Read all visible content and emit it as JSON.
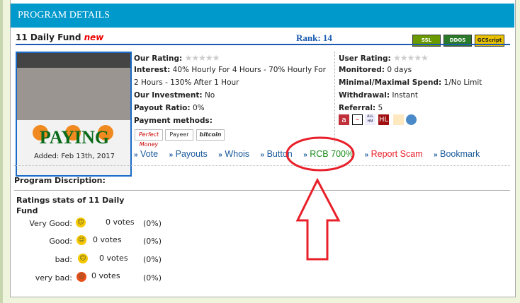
{
  "header": {
    "title": "PROGRAM DETAILS"
  },
  "program": {
    "name": "11 Daily Fund",
    "new_label": "new",
    "rank": "Rank: 14",
    "status": "PAYING",
    "added": "Added: Feb 13th, 2017"
  },
  "badges": [
    "SSL SECURED",
    "DDOS Protected",
    "GCScript"
  ],
  "info": {
    "our_rating_label": "Our Rating:",
    "interest_label": "Interest:",
    "interest_line1": "40% Hourly For 4 Hours - 70% Hourly For",
    "interest_line2": "2 Hours - 130% After 1 Hour",
    "investment_label": "Our Investment:",
    "investment": "No",
    "payout_label": "Payout Ratio:",
    "payout": "0%",
    "payment_label": "Payment methods:",
    "payment_methods": [
      "Perfect Money",
      "Payeer",
      "bitcoin"
    ]
  },
  "right": {
    "user_rating_label": "User Rating:",
    "monitored_label": "Monitored:",
    "monitored": "0 days",
    "spend_label": "Minimal/Maximal Spend:",
    "spend": "1/No Limit",
    "withdrawal_label": "Withdrawal:",
    "withdrawal": "Instant",
    "referral_label": "Referral:",
    "referral": "5",
    "monitor_icons": [
      "a",
      "~",
      "ALL HM",
      "HL",
      "chart",
      "gear"
    ]
  },
  "links": [
    "Vote",
    "Payouts",
    "Whois",
    "Button",
    "RCB 700%",
    "Report Scam",
    "Bookmark"
  ],
  "colors": {
    "header": "#0099cc",
    "paying": "#0a6a1a",
    "rcb": "#1a8a1a",
    "report": "#e8202a",
    "annotation": "#e8202a"
  },
  "description_label": "Program Discription:",
  "ratings": {
    "title_line1": "Ratings stats of 11 Daily",
    "title_line2": "Fund",
    "rows": [
      {
        "label": "Very Good:",
        "votes": "0 votes",
        "pct": "(0%)"
      },
      {
        "label": "Good:",
        "votes": "0 votes",
        "pct": "(0%)"
      },
      {
        "label": "bad:",
        "votes": "0 votes",
        "pct": "(0%)"
      },
      {
        "label": "very bad:",
        "votes": "0 votes",
        "pct": "(0%)"
      }
    ]
  }
}
